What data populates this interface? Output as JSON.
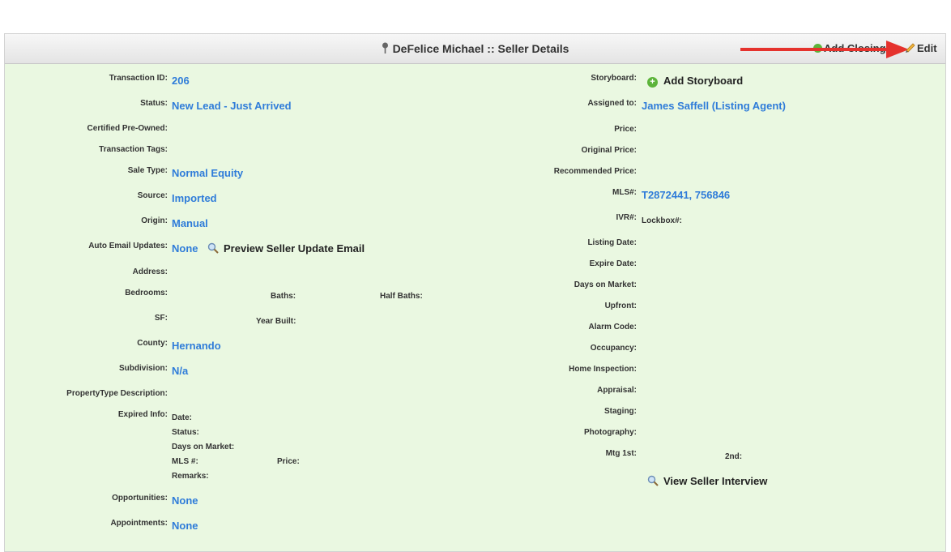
{
  "header": {
    "title": "DeFelice Michael :: Seller Details",
    "add_closing": "Add Closing",
    "edit": "Edit"
  },
  "left": {
    "transaction_id": {
      "label": "Transaction ID:",
      "value": "206"
    },
    "status": {
      "label": "Status:",
      "value": "New Lead - Just Arrived"
    },
    "certified": {
      "label": "Certified Pre-Owned:"
    },
    "tags": {
      "label": "Transaction Tags:"
    },
    "sale_type": {
      "label": "Sale Type:",
      "value": "Normal Equity"
    },
    "source": {
      "label": "Source:",
      "value": "Imported"
    },
    "origin": {
      "label": "Origin:",
      "value": "Manual"
    },
    "auto_email": {
      "label": "Auto Email Updates:",
      "value": "None",
      "action": "Preview Seller Update Email"
    },
    "address": {
      "label": "Address:"
    },
    "bedrooms": {
      "label": "Bedrooms:"
    },
    "baths": {
      "label": "Baths:"
    },
    "half_baths": {
      "label": "Half Baths:"
    },
    "sf": {
      "label": "SF:"
    },
    "year_built": {
      "label": "Year Built:"
    },
    "county": {
      "label": "County:",
      "value": "Hernando"
    },
    "subdivision": {
      "label": "Subdivision:",
      "value": "N/a"
    },
    "property_type": {
      "label": "PropertyType Description:"
    },
    "expired": {
      "label": "Expired Info:",
      "date": "Date:",
      "status": "Status:",
      "dom": "Days on Market:",
      "mls": "MLS #:",
      "price": "Price:",
      "remarks": "Remarks:"
    },
    "opportunities": {
      "label": "Opportunities:",
      "value": "None"
    },
    "appointments": {
      "label": "Appointments:",
      "value": "None"
    }
  },
  "right": {
    "storyboard": {
      "label": "Storyboard:",
      "action": "Add Storyboard"
    },
    "assigned": {
      "label": "Assigned to:",
      "value": "James Saffell (Listing Agent)"
    },
    "price": {
      "label": "Price:"
    },
    "original_price": {
      "label": "Original Price:"
    },
    "recommended_price": {
      "label": "Recommended Price:"
    },
    "mls": {
      "label": "MLS#:",
      "value": "T2872441, 756846"
    },
    "ivr": {
      "label": "IVR#:",
      "lockbox": "Lockbox#:"
    },
    "listing_date": {
      "label": "Listing Date:"
    },
    "expire_date": {
      "label": "Expire Date:"
    },
    "dom": {
      "label": "Days on Market:"
    },
    "upfront": {
      "label": "Upfront:"
    },
    "alarm": {
      "label": "Alarm Code:"
    },
    "occupancy": {
      "label": "Occupancy:"
    },
    "inspection": {
      "label": "Home Inspection:"
    },
    "appraisal": {
      "label": "Appraisal:"
    },
    "staging": {
      "label": "Staging:"
    },
    "photography": {
      "label": "Photography:"
    },
    "mtg": {
      "label": "Mtg 1st:",
      "second": "2nd:"
    },
    "interview": "View Seller Interview"
  },
  "colors": {
    "panel_bg": "#eaf8e1",
    "value_blue": "#2f7cd9",
    "arrow_red": "#e5322d"
  }
}
